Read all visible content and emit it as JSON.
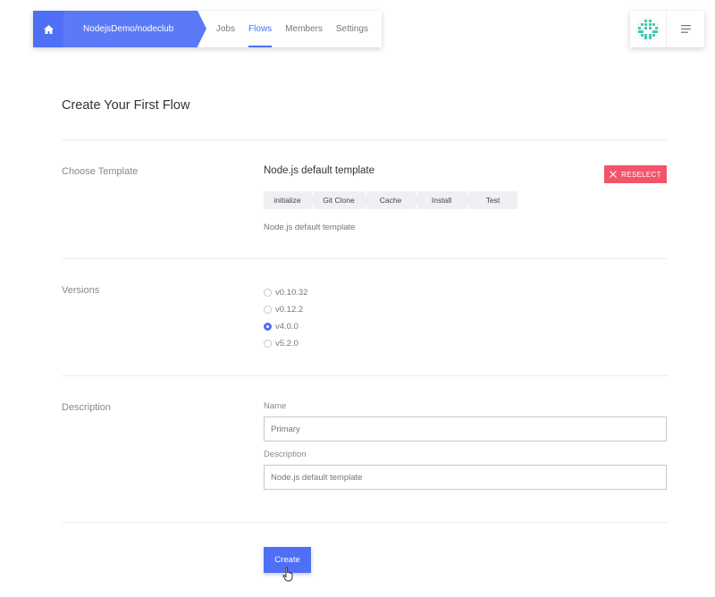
{
  "nav": {
    "repo": "NodejsDemo/nodeclub",
    "tabs": [
      {
        "label": "Jobs",
        "active": false
      },
      {
        "label": "Flows",
        "active": true
      },
      {
        "label": "Members",
        "active": false
      },
      {
        "label": "Settings",
        "active": false
      }
    ],
    "icons": {
      "home": "home-icon",
      "avatar": "user-avatar",
      "menu": "hamburger-menu-icon"
    }
  },
  "page": {
    "title": "Create Your First Flow"
  },
  "template": {
    "section_label": "Choose Template",
    "name": "Node.js default template",
    "reselect_label": "RESELECT",
    "steps": [
      "initialize",
      "Git Clone",
      "Cache",
      "Install",
      "Test"
    ],
    "description": "Node.js default template"
  },
  "versions": {
    "section_label": "Versions",
    "options": [
      "v0.10.32",
      "v0.12.2",
      "v4.0.0",
      "v5.2.0"
    ],
    "selected": "v4.0.0"
  },
  "description": {
    "section_label": "Description",
    "name_label": "Name",
    "name_placeholder": "Primary",
    "desc_label": "Description",
    "desc_placeholder": "Node.js default template"
  },
  "actions": {
    "create_label": "Create"
  },
  "colors": {
    "accent": "#4f6ff5",
    "danger": "#f2556a"
  }
}
